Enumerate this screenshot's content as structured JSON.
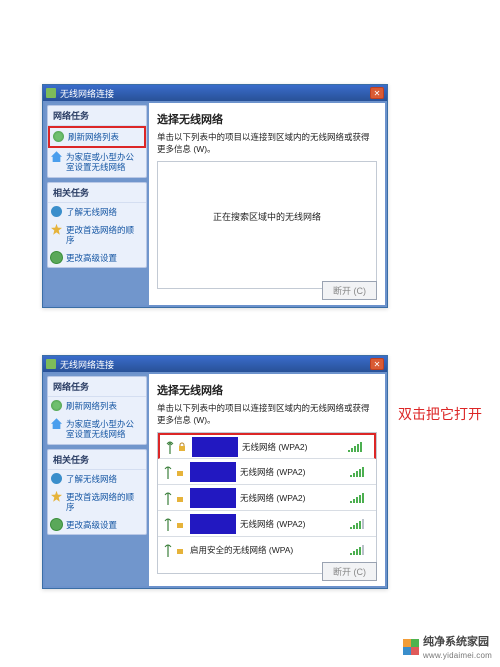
{
  "colors": {
    "red_highlight": "#dc2626",
    "titlebar": "#285197"
  },
  "window1": {
    "title": "无线网络连接",
    "sidebar": {
      "section1_title": "网络任务",
      "items1": [
        {
          "label": "刷新网络列表",
          "icon": "refresh-icon"
        },
        {
          "label": "为家庭或小型办公室设置无线网络",
          "icon": "home-icon"
        }
      ],
      "section2_title": "相关任务",
      "items2": [
        {
          "label": "了解无线网络",
          "icon": "info-icon"
        },
        {
          "label": "更改首选网络的顺序",
          "icon": "star-icon"
        },
        {
          "label": "更改高级设置",
          "icon": "gear-icon"
        }
      ]
    },
    "main": {
      "heading": "选择无线网络",
      "sub": "单击以下列表中的项目以连接到区域内的无线网络或获得更多信息 (W)。",
      "empty_msg": "正在搜索区域中的无线网络",
      "connect_btn": "断开 (C)"
    }
  },
  "window2": {
    "title": "无线网络连接",
    "sidebar": {
      "section1_title": "网络任务",
      "items1": [
        {
          "label": "刷新网络列表",
          "icon": "refresh-icon"
        },
        {
          "label": "为家庭或小型办公室设置无线网络",
          "icon": "home-icon"
        }
      ],
      "section2_title": "相关任务",
      "items2": [
        {
          "label": "了解无线网络",
          "icon": "info-icon"
        },
        {
          "label": "更改首选网络的顺序",
          "icon": "star-icon"
        },
        {
          "label": "更改高级设置",
          "icon": "gear-icon"
        }
      ]
    },
    "main": {
      "heading": "选择无线网络",
      "sub": "单击以下列表中的项目以连接到区域内的无线网络或获得更多信息 (W)。",
      "networks": [
        {
          "label": "无线网络 (WPA2)",
          "signal": 5,
          "secured": true
        },
        {
          "label": "无线网络 (WPA2)",
          "signal": 5,
          "secured": true
        },
        {
          "label": "无线网络 (WPA2)",
          "signal": 5,
          "secured": true
        },
        {
          "label": "无线网络 (WPA2)",
          "signal": 4,
          "secured": true
        },
        {
          "label": "启用安全的无线网络 (WPA)",
          "signal": 4,
          "secured": true
        }
      ],
      "connect_btn": "断开 (C)"
    }
  },
  "annotation": "双击把它打开",
  "watermark": {
    "brand": "纯净系统家园",
    "url": "www.yidaimei.com"
  }
}
